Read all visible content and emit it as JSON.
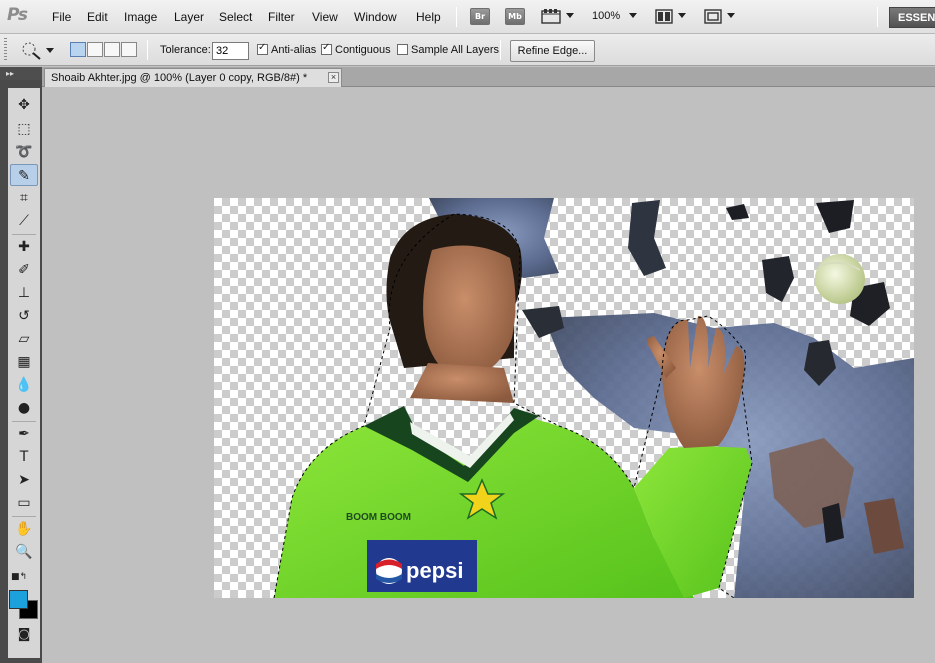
{
  "app": {
    "logo": "Ps"
  },
  "menu": [
    "File",
    "Edit",
    "Image",
    "Layer",
    "Select",
    "Filter",
    "View",
    "Window",
    "Help"
  ],
  "menubar": {
    "bridge_label": "Br",
    "minibridge_label": "Mb",
    "zoom": "100%",
    "workspace_label": "ESSENTIALS"
  },
  "options": {
    "tolerance_label": "Tolerance:",
    "tolerance_value": "32",
    "anti_alias_label": "Anti-alias",
    "anti_alias_checked": true,
    "contiguous_label": "Contiguous",
    "contiguous_checked": true,
    "sample_all_label": "Sample All Layers",
    "sample_all_checked": false,
    "refine_label": "Refine Edge..."
  },
  "document": {
    "tab_title": "Shoaib Akhter.jpg @ 100% (Layer 0 copy, RGB/8#) *"
  },
  "toolbox": {
    "tools": [
      "move-tool",
      "marquee-tool",
      "lasso-tool",
      "quick-selection-tool",
      "crop-tool",
      "eyedropper-tool",
      "healing-brush-tool",
      "brush-tool",
      "clone-stamp-tool",
      "history-brush-tool",
      "eraser-tool",
      "gradient-tool",
      "blur-tool",
      "dodge-tool",
      "pen-tool",
      "type-tool",
      "path-selection-tool",
      "shape-tool",
      "hand-tool",
      "zoom-tool"
    ],
    "active_tool": "quick-selection-tool",
    "foreground_color": "#1da1dc",
    "background_color": "#000000"
  },
  "canvas": {
    "jersey_chest_text": "BOOM BOOM",
    "sponsor_text": "pepsi"
  }
}
